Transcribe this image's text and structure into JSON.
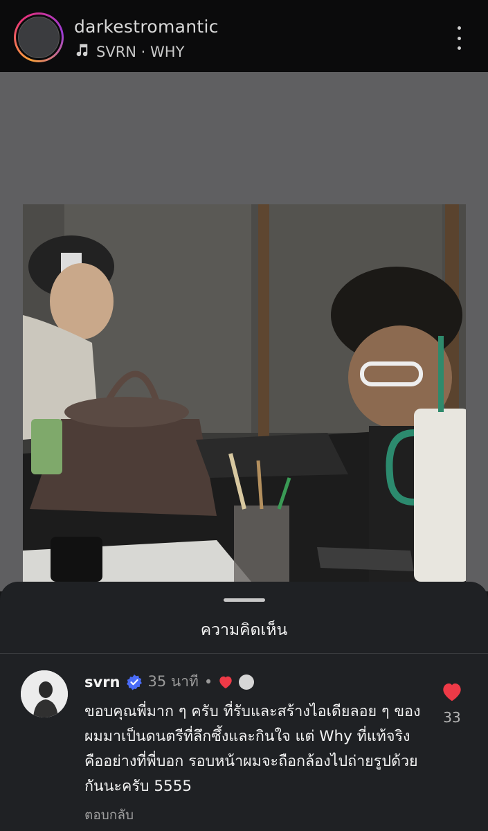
{
  "header": {
    "username": "darkestromantic",
    "music_icon": "music-note-icon",
    "music": "SVRN · WHY",
    "more_icon": "more-vertical-icon"
  },
  "sheet": {
    "title": "ความคิดเห็น"
  },
  "comment": {
    "username": "svrn",
    "verified_icon": "verified-badge-icon",
    "time": "35 นาที",
    "separator": "•",
    "text": "ขอบคุณพี่มาก ๆ ครับ ที่รับและสร้างไอเดียลอย ๆ ของผมมาเป็นดนตรีที่ลึกซึ้งและกินใจ แต่ Why ที่แท้จริงคืออย่างที่พี่บอก  รอบหน้าผมจะถือกล้องไปถ่ายรูปด้วยกันนะครับ 5555",
    "reply": "ตอบกลับ",
    "like_count": "33",
    "like_color": "#ee3a47",
    "verified_color": "#4a6cf7"
  }
}
